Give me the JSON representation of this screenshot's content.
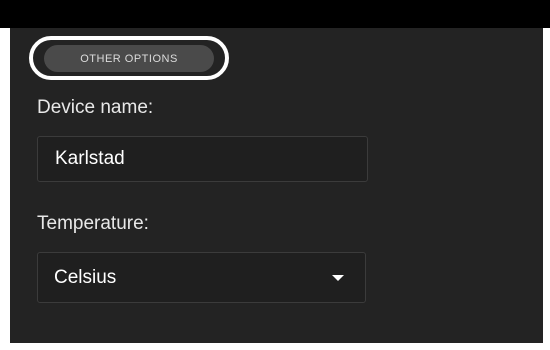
{
  "other_options": {
    "label": "OTHER OPTIONS"
  },
  "device_name": {
    "label": "Device name:",
    "value": "Karlstad"
  },
  "temperature": {
    "label": "Temperature:",
    "selected": "Celsius",
    "icon": "chevron-down-icon"
  },
  "colors": {
    "panel_bg": "#232323",
    "top_bar": "#000000",
    "highlight_ring": "#ffffff",
    "button_bg": "#4a4a4a"
  }
}
